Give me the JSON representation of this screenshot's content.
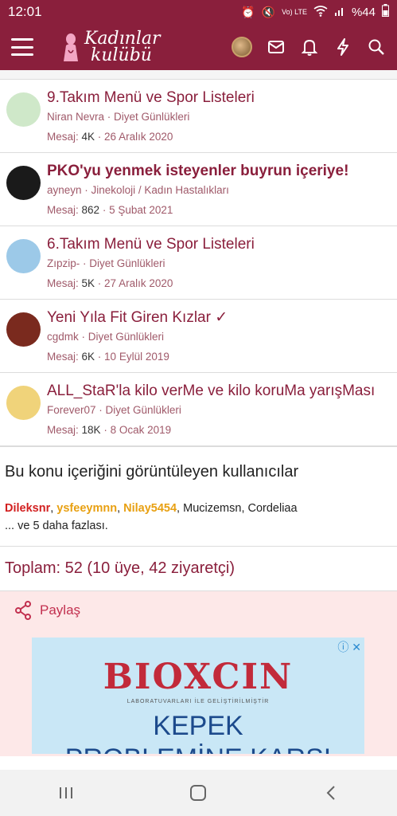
{
  "status": {
    "time": "12:01",
    "network": "Vo) LTE",
    "battery": "%44"
  },
  "header": {
    "logo_line1": "Kadınlar",
    "logo_line2": "kulübü"
  },
  "threads": [
    {
      "title": "9.Takım Menü ve Spor Listeleri",
      "bold": false,
      "author": "Niran Nevra",
      "forum": "Diyet Günlükleri",
      "replies_label": "Mesaj:",
      "replies": "4K",
      "date": "26 Aralık 2020",
      "avatar_color": "#cfe8c9"
    },
    {
      "title": "PKO'yu yenmek isteyenler buyrun içeriye!",
      "bold": true,
      "author": "ayneyn",
      "forum": "Jinekoloji / Kadın Hastalıkları",
      "replies_label": "Mesaj:",
      "replies": "862",
      "date": "5 Şubat 2021",
      "avatar_color": "#1a1a1a"
    },
    {
      "title": "6.Takım Menü ve Spor Listeleri",
      "bold": false,
      "author": "Zıpzip-",
      "forum": "Diyet Günlükleri",
      "replies_label": "Mesaj:",
      "replies": "5K",
      "date": "27 Aralık 2020",
      "avatar_color": "#9cc9e8"
    },
    {
      "title": "Yeni Yıla Fit Giren Kızlar ✓",
      "bold": false,
      "author": "cgdmk",
      "forum": "Diyet Günlükleri",
      "replies_label": "Mesaj:",
      "replies": "6K",
      "date": "10 Eylül 2019",
      "avatar_color": "#7a2a1e"
    },
    {
      "title": "ALL_StaR'la kilo verMe ve kilo koruMa yarışMası",
      "bold": false,
      "author": "Forever07",
      "forum": "Diyet Günlükleri",
      "replies_label": "Mesaj:",
      "replies": "18K",
      "date": "8 Ocak 2019",
      "avatar_color": "#f0d37a"
    }
  ],
  "viewers": {
    "title": "Bu konu içeriğini görüntüleyen kullanıcılar",
    "users": [
      {
        "name": "Dileksnr",
        "style": "red"
      },
      {
        "name": "ysfeeymnn",
        "style": "orange"
      },
      {
        "name": "Nilay5454",
        "style": "orange"
      },
      {
        "name": "Mucizemsn",
        "style": "plain"
      },
      {
        "name": "Cordeliaa",
        "style": "plain"
      }
    ],
    "more": "... ve 5 daha fazlası."
  },
  "total": "Toplam: 52 (10 üye, 42 ziyaretçi)",
  "share_label": "Paylaş",
  "ad": {
    "brand": "BIOXCIN",
    "tagline": "LABORATUVARLARI İLE GELİŞTİRİLMİŞTİR",
    "line1": "KEPEK",
    "line2": "PROBLEMİNE KARŞI"
  },
  "colors": {
    "brand": "#8a1f3c",
    "link": "#a05a6a",
    "share_bg": "#fde8e8"
  }
}
